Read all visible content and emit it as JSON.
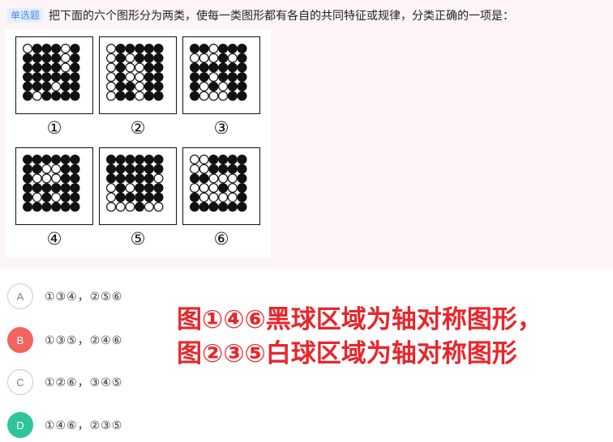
{
  "question": {
    "type_tag": "单选题",
    "text": "把下面的六个图形分为两类，使每一类图形都有各自的共同特征或规律，分类正确的一项是："
  },
  "figures": [
    {
      "label": "①",
      "grid": [
        "100010",
        "000010",
        "000010",
        "000000",
        "000100",
        "010000"
      ]
    },
    {
      "label": "②",
      "grid": [
        "100000",
        "101000",
        "101100",
        "101100",
        "100100",
        "100100"
      ]
    },
    {
      "label": "③",
      "grid": [
        "001000",
        "111010",
        "000000",
        "001000",
        "010100",
        "011100"
      ]
    },
    {
      "label": "④",
      "grid": [
        "000000",
        "001100",
        "011100",
        "000000",
        "010100",
        "000000"
      ]
    },
    {
      "label": "⑤",
      "grid": [
        "000000",
        "000000",
        "000001",
        "101000",
        "100000",
        "111011"
      ]
    },
    {
      "label": "⑥",
      "grid": [
        "110000",
        "110000",
        "001110",
        "111010",
        "011110",
        "000000"
      ]
    }
  ],
  "options": [
    {
      "letter": "A",
      "text": "①③④，②⑤⑥",
      "state": "normal"
    },
    {
      "letter": "B",
      "text": "①③⑤，②④⑥",
      "state": "wrong"
    },
    {
      "letter": "C",
      "text": "①②⑥，③④⑤",
      "state": "normal"
    },
    {
      "letter": "D",
      "text": "①④⑥，②③⑤",
      "state": "right"
    }
  ],
  "annotation": {
    "line1": "图①④⑥黑球区域为轴对称图形，",
    "line2": "图②③⑤白球区域为轴对称图形"
  },
  "colors": {
    "wrong": "#f26460",
    "right": "#2fc59a",
    "annotation": "#e8262b",
    "tag_bg": "#e6efff",
    "tag_text": "#4a86e8"
  }
}
